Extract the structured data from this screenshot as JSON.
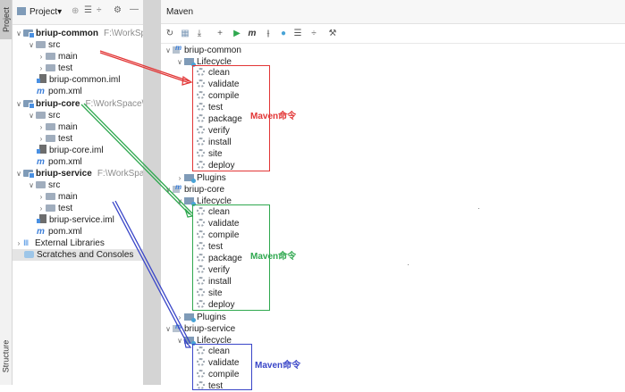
{
  "stripe": {
    "project_tab": "Project",
    "structure_tab": "Structure"
  },
  "project_panel": {
    "title": "Project",
    "tree": [
      {
        "id": "common",
        "label": "briup-common",
        "path": "F:\\WorkSpac",
        "bold": true
      },
      {
        "id": "common_src",
        "label": "src"
      },
      {
        "id": "common_main",
        "label": "main"
      },
      {
        "id": "common_test",
        "label": "test"
      },
      {
        "id": "common_iml",
        "label": "briup-common.iml"
      },
      {
        "id": "common_pom",
        "label": "pom.xml"
      },
      {
        "id": "core",
        "label": "briup-core",
        "path": "F:\\WorkSpace\\ja",
        "bold": true
      },
      {
        "id": "core_src",
        "label": "src"
      },
      {
        "id": "core_main",
        "label": "main"
      },
      {
        "id": "core_test",
        "label": "test"
      },
      {
        "id": "core_iml",
        "label": "briup-core.iml"
      },
      {
        "id": "core_pom",
        "label": "pom.xml"
      },
      {
        "id": "service",
        "label": "briup-service",
        "path": "F:\\WorkSpace",
        "bold": true
      },
      {
        "id": "service_src",
        "label": "src"
      },
      {
        "id": "service_main",
        "label": "main"
      },
      {
        "id": "service_test",
        "label": "test"
      },
      {
        "id": "service_iml",
        "label": "briup-service.iml"
      },
      {
        "id": "service_pom",
        "label": "pom.xml"
      },
      {
        "id": "ext",
        "label": "External Libraries"
      },
      {
        "id": "scratch",
        "label": "Scratches and Consoles"
      }
    ]
  },
  "maven_panel": {
    "title": "Maven",
    "modules": [
      {
        "label": "briup-common",
        "lifecycle": "Lifecycle",
        "plugins": "Plugins"
      },
      {
        "label": "briup-core",
        "lifecycle": "Lifecycle",
        "plugins": "Plugins"
      },
      {
        "label": "briup-service",
        "lifecycle": "Lifecycle"
      }
    ],
    "goals_full": [
      "clean",
      "validate",
      "compile",
      "test",
      "package",
      "verify",
      "install",
      "site",
      "deploy"
    ],
    "goals_partial": [
      "clean",
      "validate",
      "compile",
      "test"
    ]
  },
  "annotations": {
    "label1": "Maven命令",
    "label2": "Maven命令",
    "label3": "Maven命令",
    "colors": {
      "red": "#e23636",
      "green": "#2fa84f",
      "blue": "#3a46c8"
    }
  }
}
